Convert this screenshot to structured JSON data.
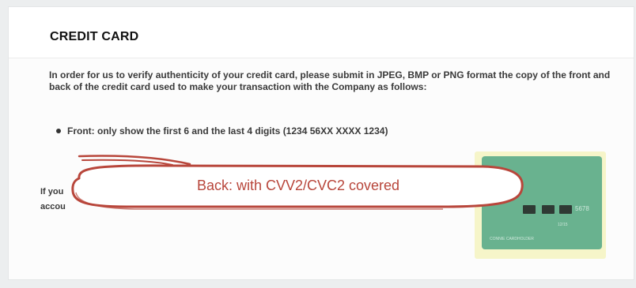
{
  "page": {
    "title": "CREDIT CARD",
    "description": "In order for us to verify authenticity of your credit card, please submit in JPEG, BMP or PNG format the copy of the front and back of the credit card used to make your transaction with the Company as follows:",
    "bullets": [
      {
        "icon": "bullet-dot-icon",
        "text": "Front: only show the first 6 and the last 4 digits (1234 56XX XXXX 1234)"
      }
    ],
    "partial_text": {
      "line1": "If you",
      "line2": "accou"
    }
  },
  "annotation": {
    "text": "Back: with CVV2/CVC2 covered",
    "stroke_color": "#b8463b",
    "fill_color": "#ffffff"
  },
  "card_image": {
    "color": "#69b28f",
    "highlight_color": "#f6f5c9",
    "number_fragment": "5678",
    "expiry_fragment": "12/15",
    "holder_fragment": "CONNIE CARDHOLDER"
  }
}
